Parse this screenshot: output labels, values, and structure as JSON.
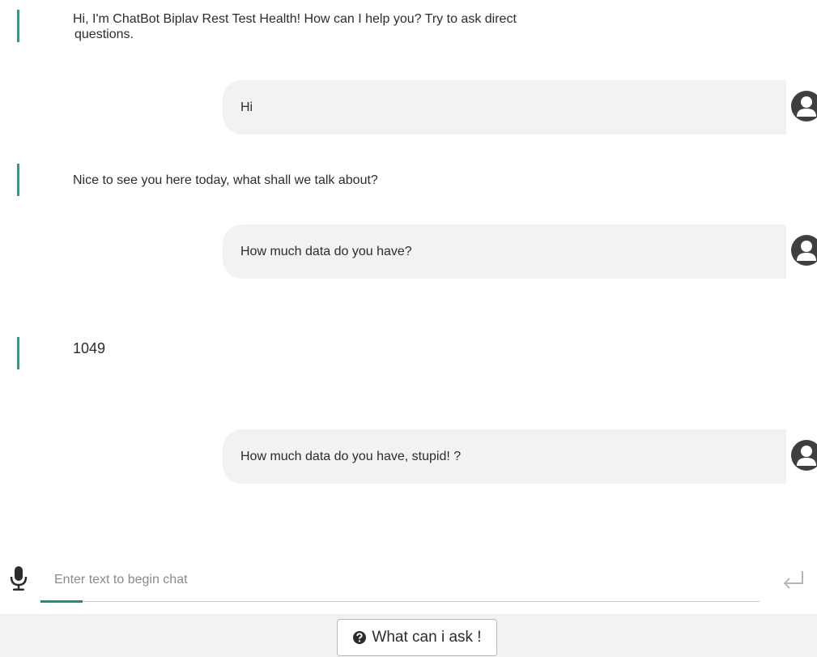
{
  "chat": {
    "messages": [
      {
        "sender": "bot",
        "text": "Hi, I'm ChatBot Biplav Rest Test Health! How can I help you? Try to ask direct questions."
      },
      {
        "sender": "user",
        "text": "Hi"
      },
      {
        "sender": "bot",
        "text": "Nice to see you here today, what shall we talk about?"
      },
      {
        "sender": "user",
        "text": "How much data do you have?"
      },
      {
        "sender": "bot",
        "text": "1049"
      },
      {
        "sender": "user",
        "text": "How much data do you have, stupid! ?"
      }
    ],
    "bot_line1": "Hi, I'm ChatBot Biplav Rest Test Health! How can I help you? Try to ask direct",
    "bot_line2": "questions."
  },
  "input": {
    "placeholder": "Enter text to begin chat",
    "value": ""
  },
  "footer": {
    "help_label": "What can i ask !"
  },
  "colors": {
    "accent": "#1aa394",
    "bubble": "#f1f2f4",
    "avatar": "#3f3f3f"
  },
  "icons": {
    "mic": "microphone-icon",
    "send": "enter-return-icon",
    "help": "question-circle-icon",
    "avatar": "user-avatar-icon"
  }
}
